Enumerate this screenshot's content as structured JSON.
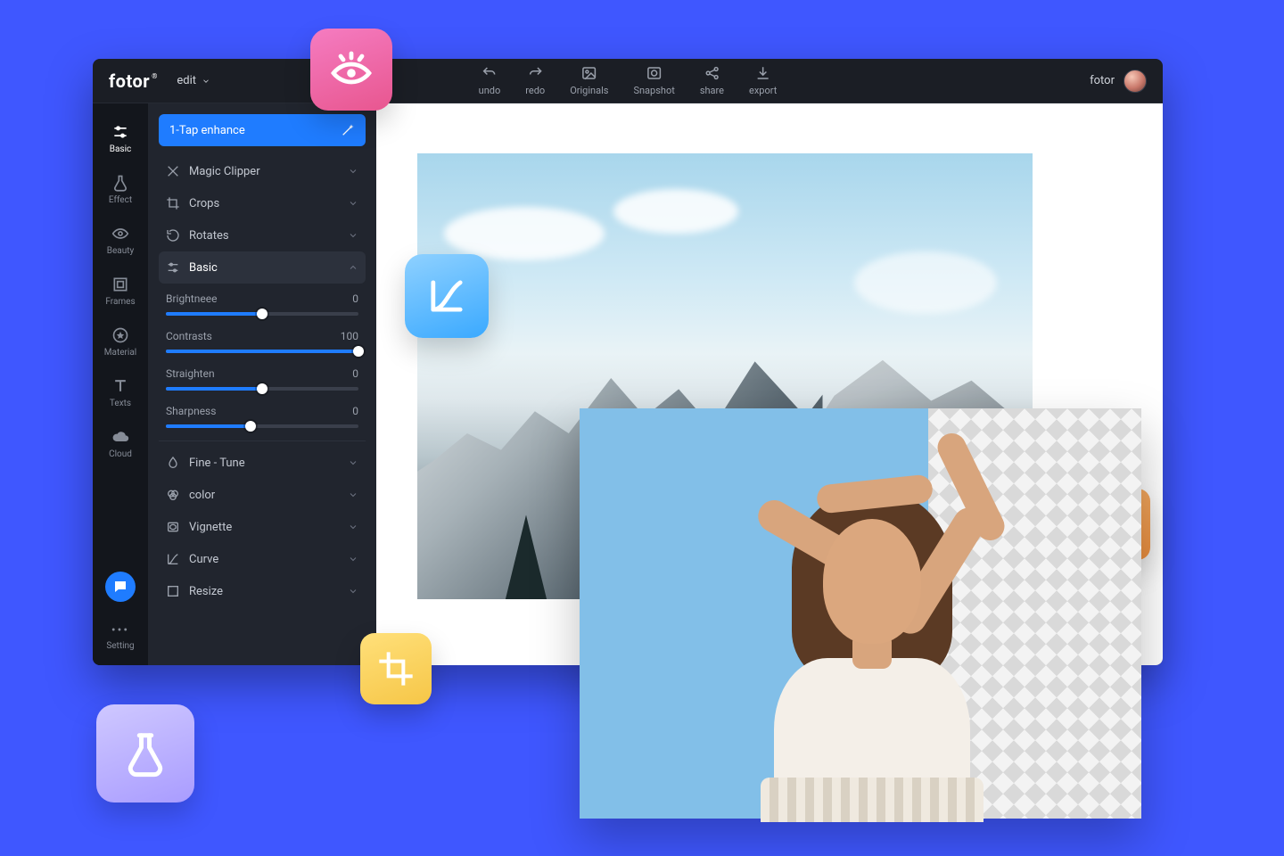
{
  "brand": {
    "name": "fotor",
    "reg": "®"
  },
  "mode": {
    "label": "edit"
  },
  "toolbar": {
    "undo": "undo",
    "redo": "redo",
    "originals": "Originals",
    "snapshot": "Snapshot",
    "share": "share",
    "export": "export"
  },
  "user": {
    "name": "fotor"
  },
  "rail": {
    "basic": "Basic",
    "effect": "Effect",
    "beauty": "Beauty",
    "frames": "Frames",
    "material": "Material",
    "texts": "Texts",
    "cloud": "Cloud",
    "setting": "Setting"
  },
  "panel": {
    "enhance": "1-Tap enhance",
    "magic_clipper": "Magic Clipper",
    "crops": "Crops",
    "rotates": "Rotates",
    "basic": "Basic",
    "fine_tune": "Fine - Tune",
    "color": "color",
    "vignette": "Vignette",
    "curve": "Curve",
    "resize": "Resize"
  },
  "sliders": {
    "brightness": {
      "label": "Brightneee",
      "value": 0,
      "min": 0,
      "max": 100,
      "pct": 50
    },
    "contrast": {
      "label": "Contrasts",
      "value": 100,
      "min": 0,
      "max": 100,
      "pct": 100
    },
    "straighten": {
      "label": "Straighten",
      "value": 0,
      "min": 0,
      "max": 100,
      "pct": 50
    },
    "sharpness": {
      "label": "Sharpness",
      "value": 0,
      "min": 0,
      "max": 100,
      "pct": 44
    }
  },
  "colors": {
    "accent": "#1f7cff",
    "page_bg": "#3f57ff",
    "panel_bg": "#21252e",
    "rail_bg": "#13161c"
  }
}
